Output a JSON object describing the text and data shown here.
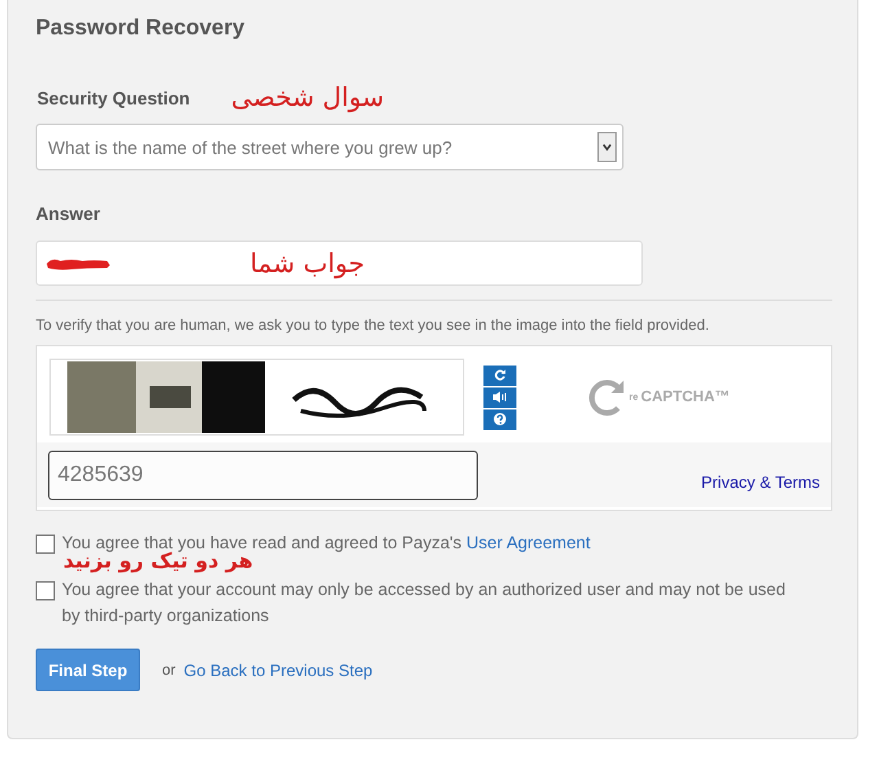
{
  "title": "Password Recovery",
  "security_question": {
    "label": "Security Question",
    "note": "سوال شخصی",
    "value": "What is the name of the street where you grew up?"
  },
  "answer": {
    "label": "Answer",
    "note": "جواب شما"
  },
  "verify_text": "To verify that you are human, we ask you to type the text you see in the image into the field provided.",
  "captcha": {
    "value": "4285639",
    "logo_prefix": "re",
    "logo": "CAPTCHA™",
    "link": "Privacy & Terms"
  },
  "agreements": [
    {
      "text": "You agree that you have read and agreed to Payza's",
      "link": "User Agreement",
      "checked": false
    },
    {
      "text": "You agree that your account may only be accessed by an authorized user and may not be used by third-party organizations",
      "checked": false
    }
  ],
  "agreements_note": "هر دو تیک رو بزنید",
  "submit": "Final Step",
  "or": "or",
  "back_link": "Go Back to Previous Step"
}
